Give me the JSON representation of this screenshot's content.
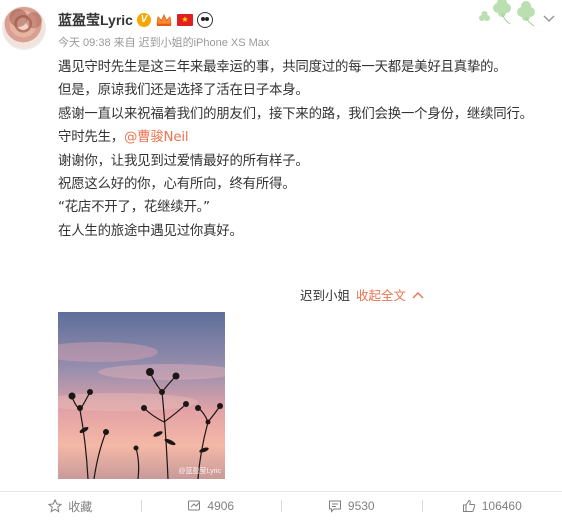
{
  "post": {
    "username": "蓝盈莹Lyric",
    "verified_badge": "V",
    "badges": [
      "verified-icon",
      "crown-icon",
      "china-flag-icon",
      "panda-icon"
    ],
    "timestamp": "今天 09:38",
    "source_prefix": "来自",
    "source": "迟到小姐的iPhone XS Max",
    "lines": [
      "遇见守时先生是这三年来最幸运的事，共同度过的每一天都是美好且真挚的。",
      "但是，原谅我们还是选择了活在日子本身。",
      "感谢一直以来祝福着我们的朋友们，接下来的路，我们会换一个身份，继续同行。",
      "守时先生，",
      "谢谢你，让我见到过爱情最好的所有样子。",
      "祝愿这么好的你，心有所向，终有所得。",
      "“花店不开了，花继续开。”",
      "在人生的旅途中遇见过你真好。"
    ],
    "mention": "@曹骏Neil",
    "collapse_user": "迟到小姐",
    "collapse_link": "收起全文",
    "image_watermark": "@蓝盈莹Lyric"
  },
  "actions": {
    "favorite_label": "收藏",
    "repost_count": "4906",
    "comment_count": "9530",
    "like_count": "106460"
  },
  "colors": {
    "accent": "#eb7350",
    "text": "#333333",
    "muted": "#999999"
  }
}
